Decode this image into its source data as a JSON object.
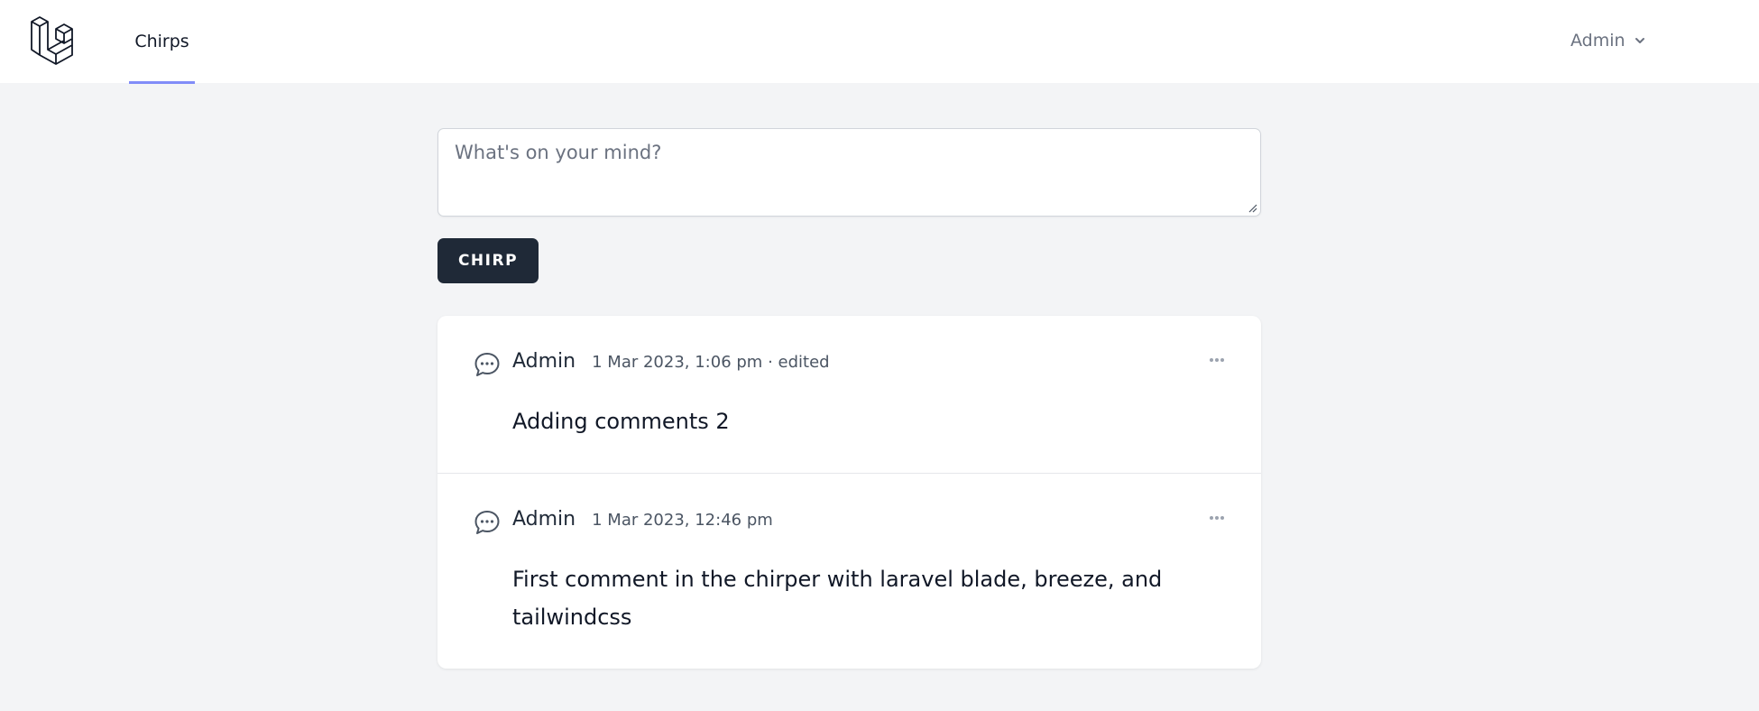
{
  "nav": {
    "logo_icon": "laravel-logo-icon",
    "links": [
      {
        "label": "Chirps",
        "active": true
      }
    ],
    "user": {
      "name": "Admin",
      "icon": "chevron-down-icon"
    }
  },
  "composer": {
    "placeholder": "What's on your mind?",
    "value": "",
    "submit_label": "CHIRP"
  },
  "chirps": [
    {
      "author": "Admin",
      "date": "1 Mar 2023, 1:06 pm",
      "edited_label": "· edited",
      "message": "Adding comments 2",
      "icon": "chat-bubble-icon",
      "menu_icon": "ellipsis-icon"
    },
    {
      "author": "Admin",
      "date": "1 Mar 2023, 12:46 pm",
      "edited_label": "",
      "message": "First comment in the chirper with laravel blade, breeze, and tailwindcss",
      "icon": "chat-bubble-icon",
      "menu_icon": "ellipsis-icon"
    }
  ],
  "colors": {
    "page_bg": "#f3f4f6",
    "nav_active_underline": "#818cf8",
    "button_bg": "#1f2937",
    "muted_text": "#6b7280"
  }
}
